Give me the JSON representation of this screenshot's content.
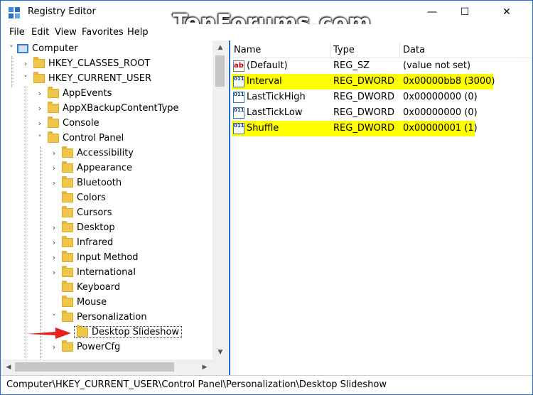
{
  "window": {
    "title": "Registry Editor",
    "watermark": "TenForums.com",
    "minimize_glyph": "—",
    "maximize_glyph": "☐",
    "close_glyph": "✕"
  },
  "menu": [
    "File",
    "Edit",
    "View",
    "Favorites",
    "Help"
  ],
  "tree": {
    "computer": "Computer",
    "hkcr": "HKEY_CLASSES_ROOT",
    "hkcu": "HKEY_CURRENT_USER",
    "appevents": "AppEvents",
    "appxbackup": "AppXBackupContentType",
    "console": "Console",
    "control_panel": "Control Panel",
    "accessibility": "Accessibility",
    "appearance": "Appearance",
    "bluetooth": "Bluetooth",
    "colors": "Colors",
    "cursors": "Cursors",
    "desktop": "Desktop",
    "infrared": "Infrared",
    "input_method": "Input Method",
    "international": "International",
    "keyboard": "Keyboard",
    "mouse": "Mouse",
    "personalization": "Personalization",
    "desktop_slideshow": "Desktop Slideshow",
    "powercfg": "PowerCfg"
  },
  "columns": {
    "name": "Name",
    "type": "Type",
    "data": "Data"
  },
  "values": [
    {
      "icon": "ab",
      "name": "(Default)",
      "type": "REG_SZ",
      "data": "(value not set)",
      "highlight": false
    },
    {
      "icon": "011",
      "name": "Interval",
      "type": "REG_DWORD",
      "data": "0x00000bb8 (3000)",
      "highlight": true
    },
    {
      "icon": "011",
      "name": "LastTickHigh",
      "type": "REG_DWORD",
      "data": "0x00000000 (0)",
      "highlight": false
    },
    {
      "icon": "011",
      "name": "LastTickLow",
      "type": "REG_DWORD",
      "data": "0x00000000 (0)",
      "highlight": false
    },
    {
      "icon": "011",
      "name": "Shuffle",
      "type": "REG_DWORD",
      "data": "0x00000001 (1)",
      "highlight": true
    }
  ],
  "status": "Computer\\HKEY_CURRENT_USER\\Control Panel\\Personalization\\Desktop Slideshow",
  "colors": {
    "highlight": "#ffff00",
    "window_border": "#1f6ed4",
    "arrow": "#e8201b"
  }
}
